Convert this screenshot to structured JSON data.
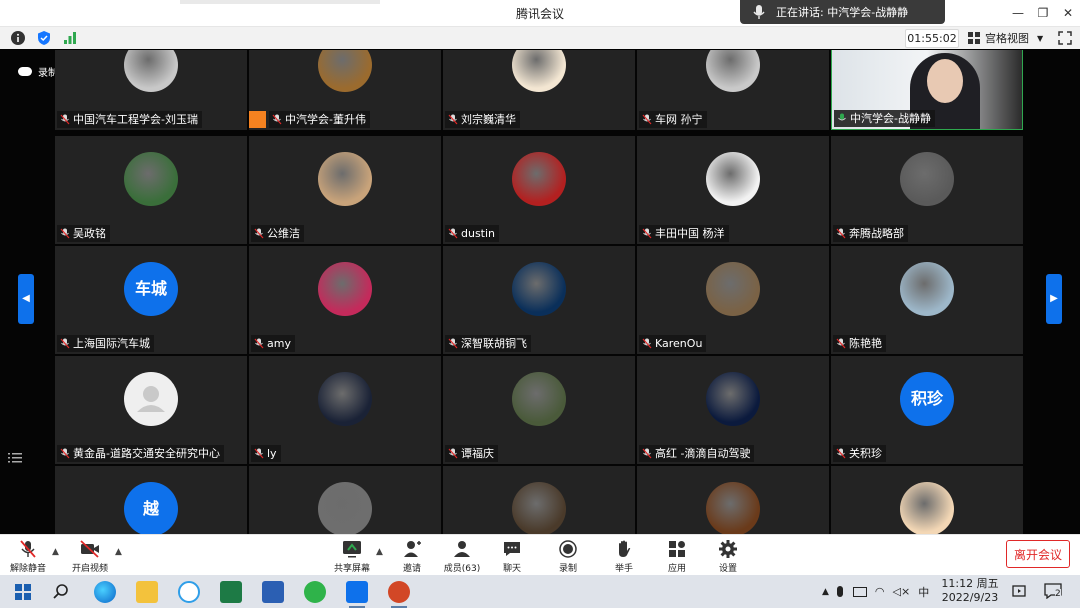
{
  "window": {
    "title": "腾讯会议"
  },
  "speaker_banner": {
    "text": "正在讲话: 中汽学会-战静静"
  },
  "infobar": {
    "timer": "01:55:02",
    "view_mode": "宫格视图"
  },
  "recording": {
    "label": "录制中"
  },
  "tiles": [
    {
      "name": "中国汽车工程学会-刘玉瑞",
      "avatar": "photo"
    },
    {
      "name": "中汽学会-董升伟",
      "avatar": "photo",
      "host": true
    },
    {
      "name": "刘宗巍清华",
      "avatar": "photo"
    },
    {
      "name": "车网 孙宁",
      "avatar": "photo"
    },
    {
      "name": "中汽学会-战静静",
      "avatar": "video",
      "speaking": true
    },
    {
      "name": "吴政铭",
      "avatar": "photo"
    },
    {
      "name": "公维洁",
      "avatar": "photo"
    },
    {
      "name": "dustin",
      "avatar": "photo"
    },
    {
      "name": "丰田中国 杨洋",
      "avatar": "photo"
    },
    {
      "name": "奔腾战略部",
      "avatar": "photo"
    },
    {
      "name": "上海国际汽车城",
      "avatar": "letter",
      "letter": "车城"
    },
    {
      "name": "amy",
      "avatar": "photo"
    },
    {
      "name": "深智联胡铜飞",
      "avatar": "photo"
    },
    {
      "name": "KarenOu",
      "avatar": "photo"
    },
    {
      "name": "陈艳艳",
      "avatar": "photo"
    },
    {
      "name": "黄金晶-道路交通安全研究中心",
      "avatar": "default"
    },
    {
      "name": "ly",
      "avatar": "photo"
    },
    {
      "name": "谭福庆",
      "avatar": "photo"
    },
    {
      "name": "高红 -滴滴自动驾驶",
      "avatar": "photo"
    },
    {
      "name": "关积珍",
      "avatar": "letter",
      "letter": "积珍"
    },
    {
      "name": "",
      "avatar": "letter",
      "letter": "越"
    },
    {
      "name": "",
      "avatar": "photo"
    },
    {
      "name": "",
      "avatar": "photo"
    },
    {
      "name": "",
      "avatar": "photo"
    },
    {
      "name": "",
      "avatar": "photo"
    }
  ],
  "avatar_colors": [
    "#c8c8c8",
    "#9b6b2e",
    "#f3e6d2",
    "#c9c9c9",
    "#e8ecef",
    "#3a6e3a",
    "#c8a37a",
    "#b32020",
    "#f2f2f2",
    "#5a5a5a",
    "#0e71eb",
    "#c42a5b",
    "#0a2f5a",
    "#7a6245",
    "#9db7c9",
    "#efefef",
    "#1a2236",
    "#4a5a3a",
    "#0b1a3d",
    "#0e71eb",
    "#0e71eb",
    "#6e6e6e",
    "#4a3a2a",
    "#6a3a1a",
    "#f3d7b5"
  ],
  "controls": {
    "unmute": "解除静音",
    "start_video": "开启视频",
    "share": "共享屏幕",
    "invite": "邀请",
    "members": "成员(63)",
    "chat": "聊天",
    "record": "录制",
    "raise_hand": "举手",
    "apps": "应用",
    "settings": "设置",
    "leave": "离开会议"
  },
  "taskbar": {
    "ime": "中",
    "time": "11:12 周五",
    "date": "2022/9/23",
    "notification_count": "2"
  }
}
